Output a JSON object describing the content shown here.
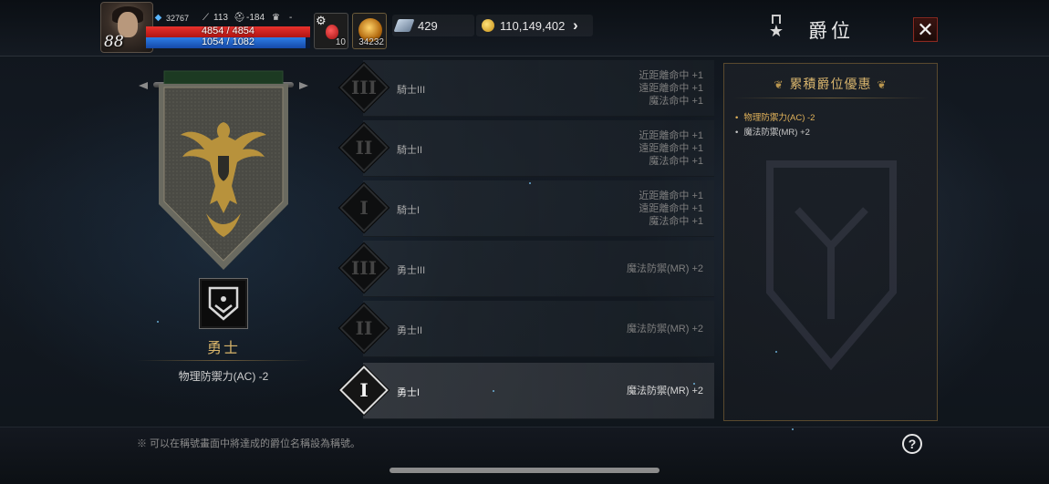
{
  "player": {
    "level": "88",
    "stat_crystal": "32767",
    "stat_attack": "113",
    "stat_helm": "-184",
    "stat_trophy": "-",
    "hp": "4854 / 4854",
    "hp_ratio": 1.0,
    "mp": "1054 / 1082",
    "mp_ratio": 0.974
  },
  "quickslots": [
    {
      "icon": "red-potion-icon",
      "count": "10"
    },
    {
      "icon": "gold-potion-icon",
      "count": "34232"
    }
  ],
  "currency": {
    "gem_amount": "429",
    "gold_amount": "110,149,402"
  },
  "header": {
    "title": "爵位",
    "close_label": "✕"
  },
  "current_rank": {
    "name": "勇士",
    "bonus": "物理防禦力(AC) -2"
  },
  "ranks": [
    {
      "roman": "III",
      "name": "騎士III",
      "bonuses": [
        "近距離命中 +1",
        "遠距離命中 +1",
        "魔法命中 +1"
      ],
      "selected": false
    },
    {
      "roman": "II",
      "name": "騎士II",
      "bonuses": [
        "近距離命中 +1",
        "遠距離命中 +1",
        "魔法命中 +1"
      ],
      "selected": false
    },
    {
      "roman": "I",
      "name": "騎士I",
      "bonuses": [
        "近距離命中 +1",
        "遠距離命中 +1",
        "魔法命中 +1"
      ],
      "selected": false
    },
    {
      "roman": "III",
      "name": "勇士III",
      "bonuses": [
        "魔法防禦(MR) +2"
      ],
      "selected": false
    },
    {
      "roman": "II",
      "name": "勇士II",
      "bonuses": [
        "魔法防禦(MR) +2"
      ],
      "selected": false
    },
    {
      "roman": "I",
      "name": "勇士I",
      "bonuses": [
        "魔法防禦(MR) +2"
      ],
      "selected": true
    }
  ],
  "cumulative": {
    "title": "累積爵位優惠",
    "items": [
      {
        "text": "物理防禦力(AC) -2",
        "highlight": true
      },
      {
        "text": "魔法防禦(MR) +2",
        "highlight": false
      }
    ]
  },
  "footer": {
    "note": "※ 可以在稱號畫面中將達成的爵位名稱設為稱號。",
    "help_label": "?"
  },
  "colors": {
    "accent_gold": "#d6b36c",
    "hp_red": "#e8312c",
    "mp_blue": "#2d7ee6",
    "close_red": "#8a2a22"
  }
}
